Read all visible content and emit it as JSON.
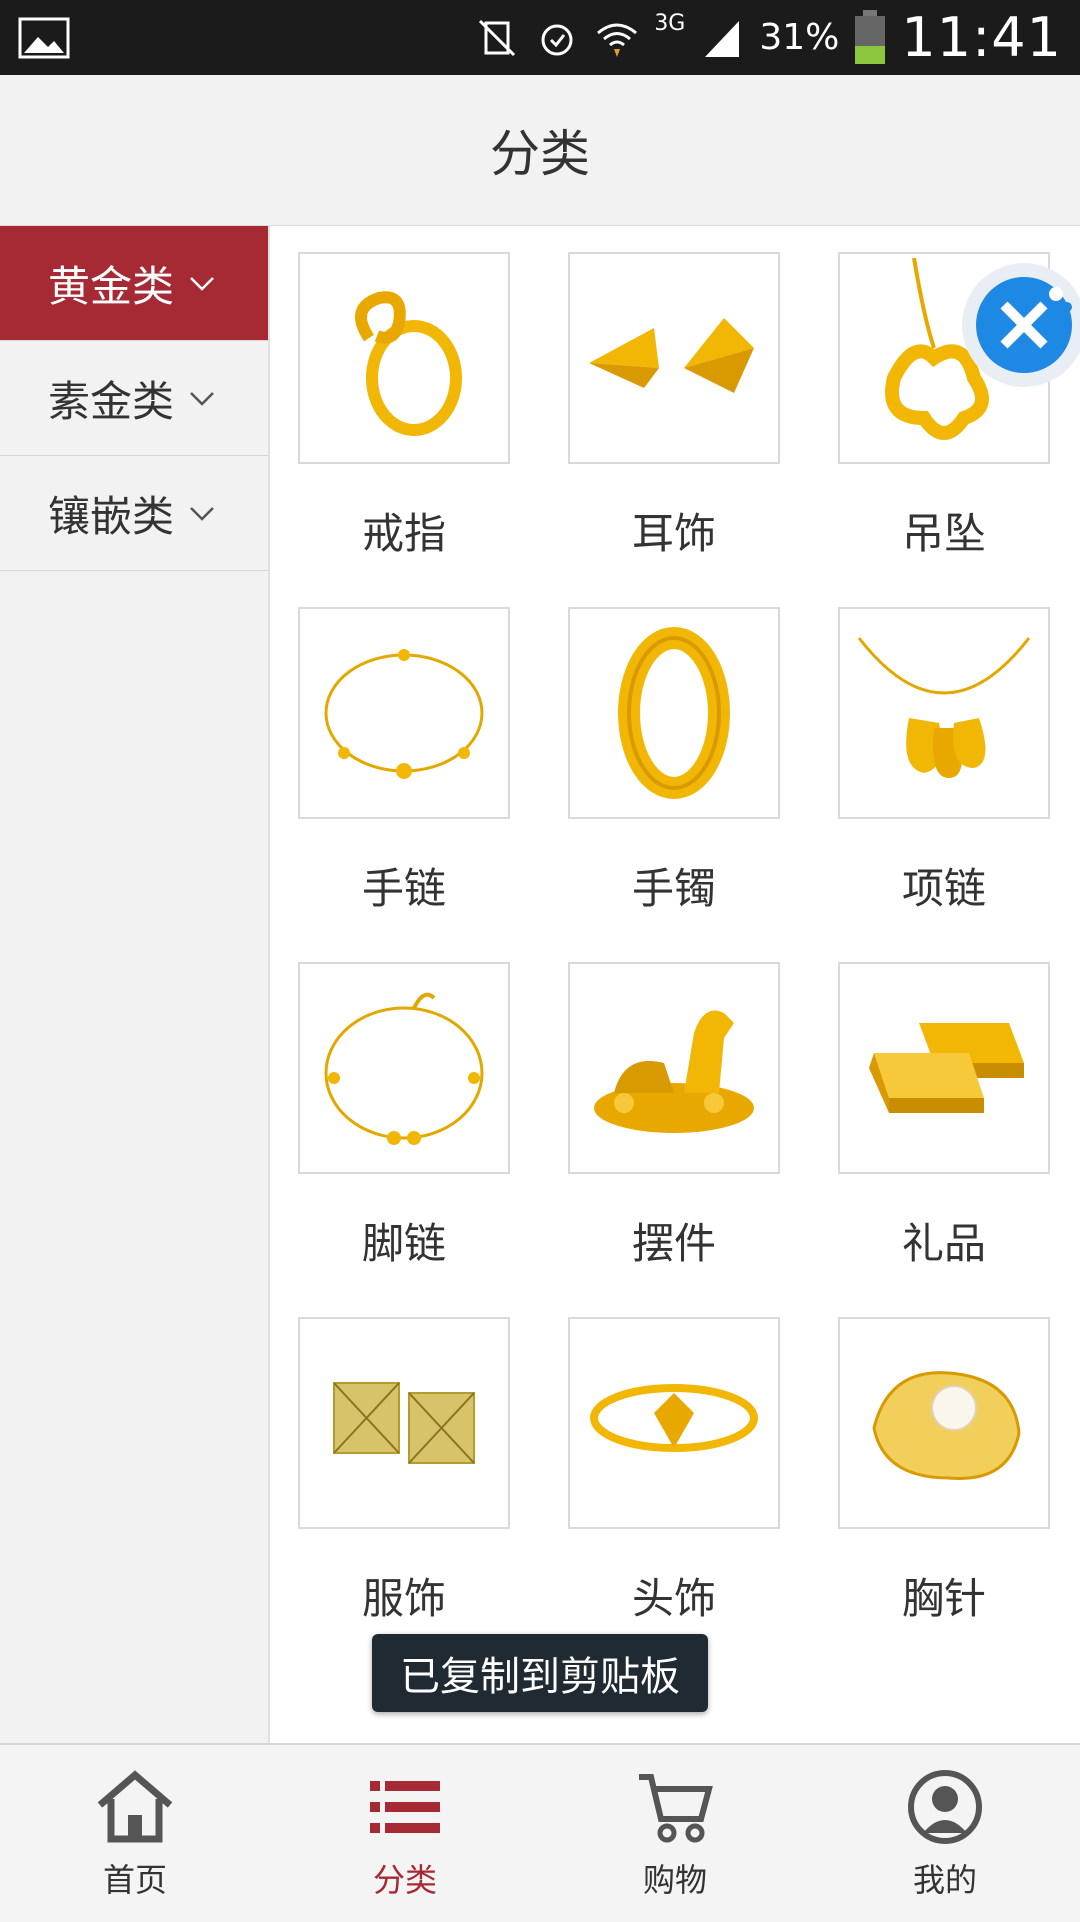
{
  "status_bar": {
    "battery": "31%",
    "time": "11:41",
    "network": "3G"
  },
  "header": {
    "title": "分类"
  },
  "sidebar": {
    "categories": [
      {
        "label": "黄金类",
        "active": true
      },
      {
        "label": "素金类",
        "active": false
      },
      {
        "label": "镶嵌类",
        "active": false
      }
    ]
  },
  "grid": {
    "items": [
      {
        "label": "戒指",
        "icon": "ring"
      },
      {
        "label": "耳饰",
        "icon": "earrings"
      },
      {
        "label": "吊坠",
        "icon": "pendant"
      },
      {
        "label": "手链",
        "icon": "bracelet-chain"
      },
      {
        "label": "手镯",
        "icon": "bangle"
      },
      {
        "label": "项链",
        "icon": "necklace"
      },
      {
        "label": "脚链",
        "icon": "anklet"
      },
      {
        "label": "摆件",
        "icon": "horse-ornament"
      },
      {
        "label": "礼品",
        "icon": "gold-bars"
      },
      {
        "label": "服饰",
        "icon": "cufflinks"
      },
      {
        "label": "头饰",
        "icon": "head-ornament"
      },
      {
        "label": "胸针",
        "icon": "brooch"
      }
    ]
  },
  "toast": {
    "text": "已复制到剪贴板"
  },
  "bottom_nav": {
    "tabs": [
      {
        "label": "首页",
        "icon": "home-icon",
        "active": false
      },
      {
        "label": "分类",
        "icon": "list-icon",
        "active": true
      },
      {
        "label": "购物",
        "icon": "cart-icon",
        "active": false
      },
      {
        "label": "我的",
        "icon": "user-icon",
        "active": false
      }
    ]
  },
  "colors": {
    "accent": "#a52a34",
    "gold": "#f2b705",
    "float_button": "#1e88e5"
  }
}
